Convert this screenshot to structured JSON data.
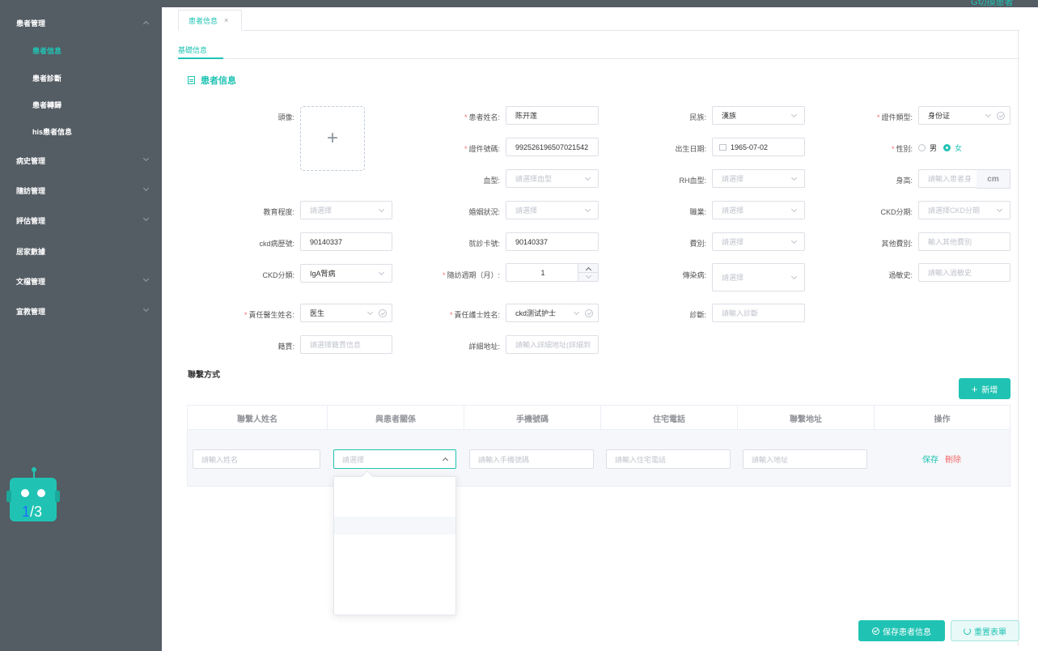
{
  "colors": {
    "accent": "#20c3b3",
    "sidebar": "#545c64",
    "danger": "#f56c6c"
  },
  "sidebar": {
    "items": [
      {
        "label": "患者管理"
      },
      {
        "label": "患者信息"
      },
      {
        "label": "患者診斷"
      },
      {
        "label": "患者轉歸"
      },
      {
        "label": "his患者信息"
      },
      {
        "label": "病史管理"
      },
      {
        "label": "隨訪管理"
      },
      {
        "label": "評估管理"
      },
      {
        "label": "居家數據"
      },
      {
        "label": "文檔管理"
      },
      {
        "label": "宣教管理"
      }
    ]
  },
  "robot": {
    "page_current": "1",
    "page_total": "/3"
  },
  "header": {
    "top_right": "G切換患者"
  },
  "tabs": [
    {
      "label": "患者信息",
      "close": "×"
    }
  ],
  "subtabs": [
    {
      "label": "基礎信息"
    }
  ],
  "section_title": "患者信息",
  "form": {
    "avatar_label": "頭像:",
    "upload_plus": "+",
    "name_label": "患者姓名:",
    "name_value": "陈开莲",
    "ethnic_label": "民族:",
    "ethnic_value": "漢族",
    "idtype_label": "證件類型:",
    "idtype_value": "身份证",
    "idno_label": "證件號碼:",
    "idno_value": "992526196507021542",
    "birth_label": "出生日期:",
    "birth_value": "1965-07-02",
    "gender_label": "性別:",
    "gender_male": "男",
    "gender_female": "女",
    "blood_label": "血型:",
    "blood_ph": "請選擇血型",
    "rh_label": "RH血型:",
    "rh_ph": "請選擇",
    "height_label": "身高:",
    "height_ph": "請輸入患者身",
    "height_unit": "cm",
    "edu_label": "教育程度:",
    "edu_ph": "請選擇",
    "marital_label": "婚姻狀況:",
    "marital_ph": "請選擇",
    "job_label": "職業:",
    "job_ph": "請選擇",
    "ckdstage_label": "CKD分期:",
    "ckdstage_ph": "請選擇CKD分期",
    "ckdno_label": "ckd病歷號:",
    "ckdno_value": "90140337",
    "visit_label": "就診卡號:",
    "visit_value": "90140337",
    "fee_label": "費別:",
    "fee_ph": "請選擇",
    "otherfee_label": "其他費別:",
    "otherfee_ph": "輸入其他費別",
    "ckdtype_label": "CKD分類:",
    "ckdtype_value": "IgA腎病",
    "cycle_label": "隨訪週期（月）:",
    "cycle_value": "1",
    "infect_label": "傳染病:",
    "infect_ph": "請選擇",
    "allergy_label": "過敏史:",
    "allergy_ph": "請輸入過敏史",
    "doctor_label": "責任醫生姓名:",
    "doctor_value": "医生",
    "nurse_label": "責任護士姓名:",
    "nurse_value": "ckd测试护士",
    "diag_label": "診斷:",
    "diag_ph": "請輸入診斷",
    "native_label": "籍貫:",
    "native_ph": "請選擇籍貫信息",
    "addr_label": "詳細地址:",
    "addr_ph": "請輸入詳細地址(詳細到"
  },
  "contact": {
    "title": "聯繫方式",
    "add_label": "新增",
    "columns": [
      "聯繫人姓名",
      "與患者關係",
      "手機號碼",
      "住宅電話",
      "聯繫地址",
      "操作"
    ],
    "row": {
      "name_ph": "請輸入姓名",
      "relation_ph": "請選擇",
      "mobile_ph": "請輸入手機號碼",
      "phone_ph": "請輸入住宅電話",
      "address_ph": "請輸入地址",
      "save": "保存",
      "delete": "刪除"
    }
  },
  "footer": {
    "save_label": "保存患者信息",
    "reset_label": "重置表單"
  }
}
